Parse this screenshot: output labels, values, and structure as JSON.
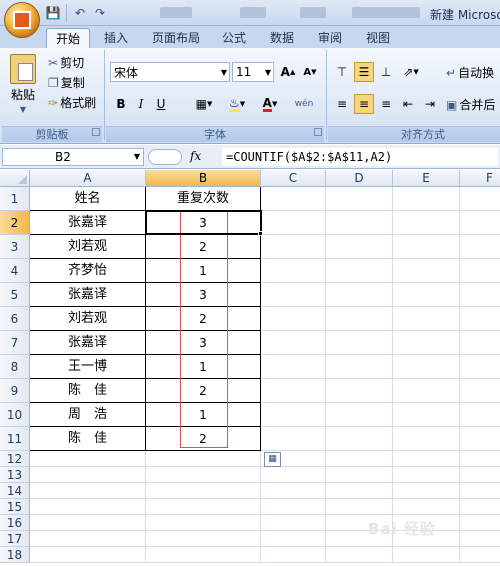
{
  "window": {
    "title": "新建 Microso"
  },
  "ribbon_tabs": [
    "开始",
    "插入",
    "页面布局",
    "公式",
    "数据",
    "审阅",
    "视图"
  ],
  "clipboard": {
    "paste": "粘贴",
    "cut": "剪切",
    "copy": "复制",
    "format_painter": "格式刷",
    "group": "剪贴板"
  },
  "font": {
    "name": "宋体",
    "size": "11",
    "group": "字体",
    "grow": "A",
    "shrink": "A",
    "bold": "B",
    "italic": "I",
    "underline": "U",
    "font_color": "A",
    "phonetic": "wén"
  },
  "alignment": {
    "wrap": "自动换",
    "merge": "合并后",
    "group": "对齐方式"
  },
  "formula_bar": {
    "name_box": "B2",
    "fx": "fx",
    "formula": "=COUNTIF($A$2:$A$11,A2)"
  },
  "columns": [
    "A",
    "B",
    "C",
    "D",
    "E",
    "F"
  ],
  "rows": [
    "1",
    "2",
    "3",
    "4",
    "5",
    "6",
    "7",
    "8",
    "9",
    "10",
    "11",
    "12",
    "13",
    "14",
    "15",
    "16",
    "17",
    "18"
  ],
  "table": {
    "header": [
      "姓名",
      "重复次数"
    ],
    "data": [
      [
        "张嘉译",
        "3"
      ],
      [
        "刘若观",
        "2"
      ],
      [
        "齐梦怡",
        "1"
      ],
      [
        "张嘉译",
        "3"
      ],
      [
        "刘若观",
        "2"
      ],
      [
        "张嘉译",
        "3"
      ],
      [
        "王一博",
        "1"
      ],
      [
        "陈　佳",
        "2"
      ],
      [
        "周　浩",
        "1"
      ],
      [
        "陈　佳",
        "2"
      ]
    ]
  },
  "active_cell": "B2"
}
